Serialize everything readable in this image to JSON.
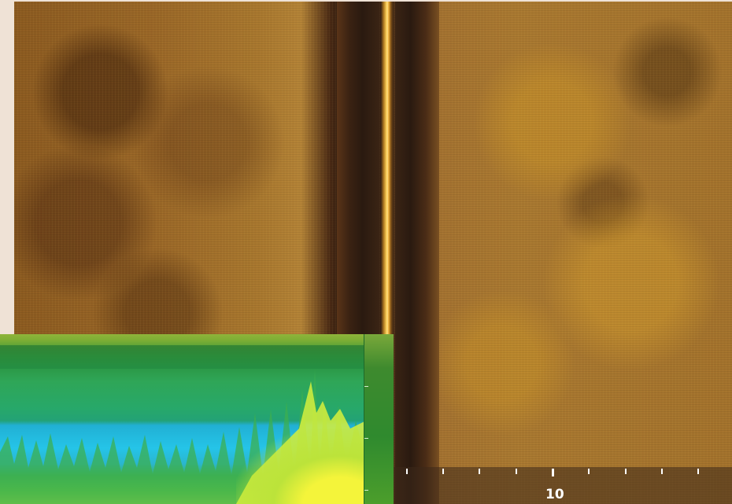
{
  "sidescan": {
    "scale_label": "10",
    "colors": {
      "seabed": "#a3722c",
      "water_column": "#2c1a10",
      "nadir_line": "#ffd45a"
    }
  },
  "echo_panel": {
    "colors": {
      "surface": "#8fb43a",
      "mid_column": "#2fa657",
      "layer": "#25c4e8",
      "strong_return": "#f4f43a"
    }
  }
}
